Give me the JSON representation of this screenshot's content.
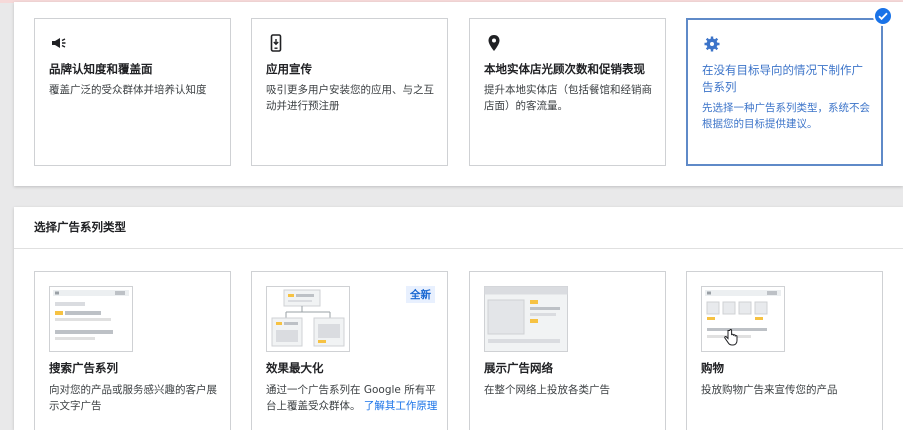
{
  "goals": [
    {
      "title": "品牌认知度和覆盖面",
      "desc": "覆盖广泛的受众群体并培养认知度",
      "icon": "megaphone-icon"
    },
    {
      "title": "应用宣传",
      "desc": "吸引更多用户安装您的应用、与之互动并进行预注册",
      "icon": "phone-icon"
    },
    {
      "title": "本地实体店光顾次数和促销表现",
      "desc": "提升本地实体店（包括餐馆和经销商店面）的客流量。",
      "icon": "location-pin-icon"
    },
    {
      "title": "在没有目标导向的情况下制作广告系列",
      "desc": "先选择一种广告系列类型，系统不会根据您的目标提供建议。",
      "icon": "gear-icon",
      "selected": true
    }
  ],
  "section_title": "选择广告系列类型",
  "campaign_types": [
    {
      "title": "搜索广告系列",
      "desc": "向对您的产品或服务感兴趣的客户展示文字广告"
    },
    {
      "title": "效果最大化",
      "desc": "通过一个广告系列在 Google 所有平台上覆盖受众群体。",
      "link": "了解其工作原理",
      "badge": "全新"
    },
    {
      "title": "展示广告网络",
      "desc": "在整个网络上投放各类广告"
    },
    {
      "title": "购物",
      "desc": "投放购物广告来宣传您的产品"
    }
  ],
  "colors": {
    "accent": "#1a73e8",
    "selected_border": "#5f8ac8",
    "illustration_yellow": "#f6c243"
  }
}
